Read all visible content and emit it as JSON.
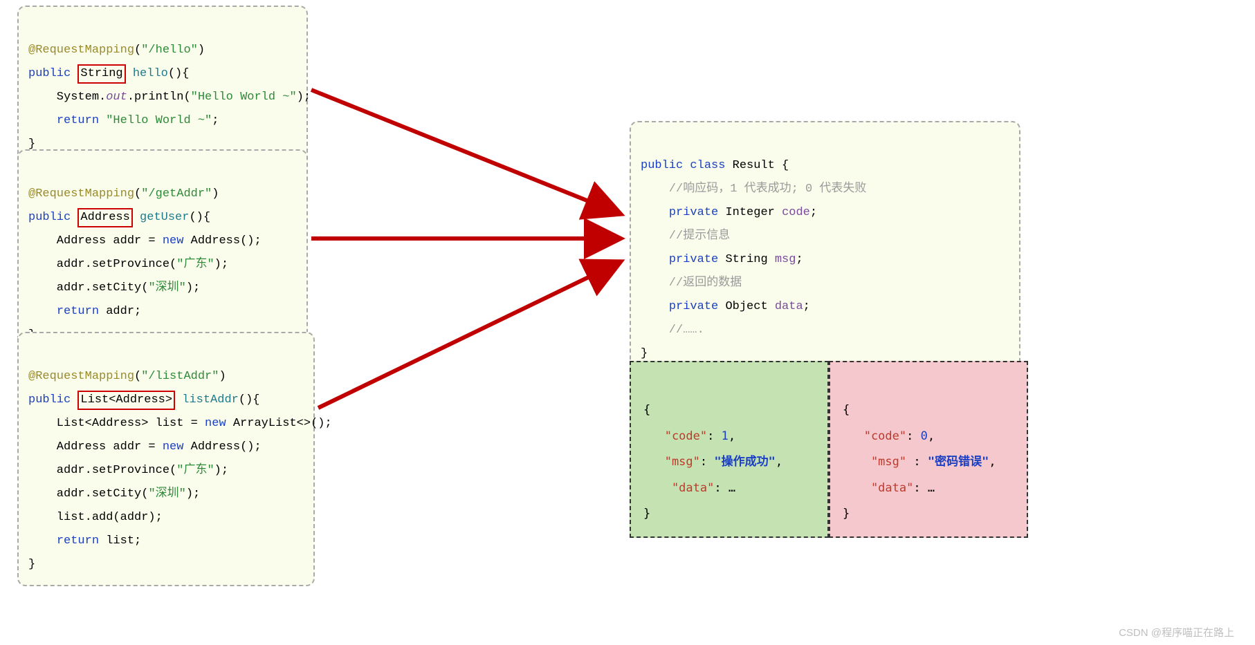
{
  "box1": {
    "l1a": "@RequestMapping",
    "l1b": "(",
    "l1c": "\"/hello\"",
    "l1d": ")",
    "l2a": "public",
    "l2b": "String",
    "l2c": "hello",
    "l2d": "(){",
    "l3a": "    System.",
    "l3b": "out",
    "l3c": ".println(",
    "l3d": "\"Hello World ~\"",
    "l3e": ");",
    "l4a": "    ",
    "l4b": "return ",
    "l4c": "\"Hello World ~\"",
    "l4d": ";",
    "l5": "}"
  },
  "box2": {
    "l1a": "@RequestMapping",
    "l1b": "(",
    "l1c": "\"/getAddr\"",
    "l1d": ")",
    "l2a": "public",
    "l2b": "Address",
    "l2c": "getUser",
    "l2d": "(){",
    "l3a": "    Address addr = ",
    "l3b": "new ",
    "l3c": "Address();",
    "l4a": "    addr.setProvince(",
    "l4b": "\"广东\"",
    "l4c": ");",
    "l5a": "    addr.setCity(",
    "l5b": "\"深圳\"",
    "l5c": ");",
    "l6a": "    ",
    "l6b": "return ",
    "l6c": "addr;",
    "l7": "}"
  },
  "box3": {
    "l1a": "@RequestMapping",
    "l1b": "(",
    "l1c": "\"/listAddr\"",
    "l1d": ")",
    "l2a": "public",
    "l2b": "List<Address>",
    "l2c": "listAddr",
    "l2d": "(){",
    "l3a": "    List<Address> list = ",
    "l3b": "new ",
    "l3c": "ArrayList<>();",
    "l4a": "    Address addr = ",
    "l4b": "new ",
    "l4c": "Address();",
    "l5a": "    addr.setProvince(",
    "l5b": "\"广东\"",
    "l5c": ");",
    "l6a": "    addr.setCity(",
    "l6b": "\"深圳\"",
    "l6c": ");",
    "l7": "    list.add(addr);",
    "l8a": "    ",
    "l8b": "return ",
    "l8c": "list;",
    "l9": "}"
  },
  "result": {
    "l1a": "public class ",
    "l1b": "Result {",
    "l2": "    //响应码，1 代表成功; 0 代表失败",
    "l3a": "    ",
    "l3b": "private ",
    "l3c": "Integer ",
    "l3d": "code",
    "l3e": ";",
    "l4": "    //提示信息",
    "l5a": "    ",
    "l5b": "private ",
    "l5c": "String ",
    "l5d": "msg",
    "l5e": ";",
    "l6": "    //返回的数据",
    "l7a": "    ",
    "l7b": "private ",
    "l7c": "Object ",
    "l7d": "data",
    "l7e": ";",
    "l8": "    //…….",
    "l9": "}"
  },
  "jsonOk": {
    "l1": "{",
    "l2a": "   \"code\"",
    "l2b": ": ",
    "l2c": "1",
    "l2d": ",",
    "l3a": "   \"msg\"",
    "l3b": ": ",
    "l3c": "\"操作成功\"",
    "l3d": ",",
    "l4a": "    \"data\"",
    "l4b": ": …",
    "l5": "}"
  },
  "jsonErr": {
    "l1": "{",
    "l2a": "   \"code\"",
    "l2b": ": ",
    "l2c": "0",
    "l2d": ",",
    "l3a": "    \"msg\" ",
    "l3b": ": ",
    "l3c": "\"密码错误\"",
    "l3d": ",",
    "l4a": "    \"data\"",
    "l4b": ": …",
    "l5": "}"
  },
  "watermark": "CSDN @程序喵正在路上"
}
